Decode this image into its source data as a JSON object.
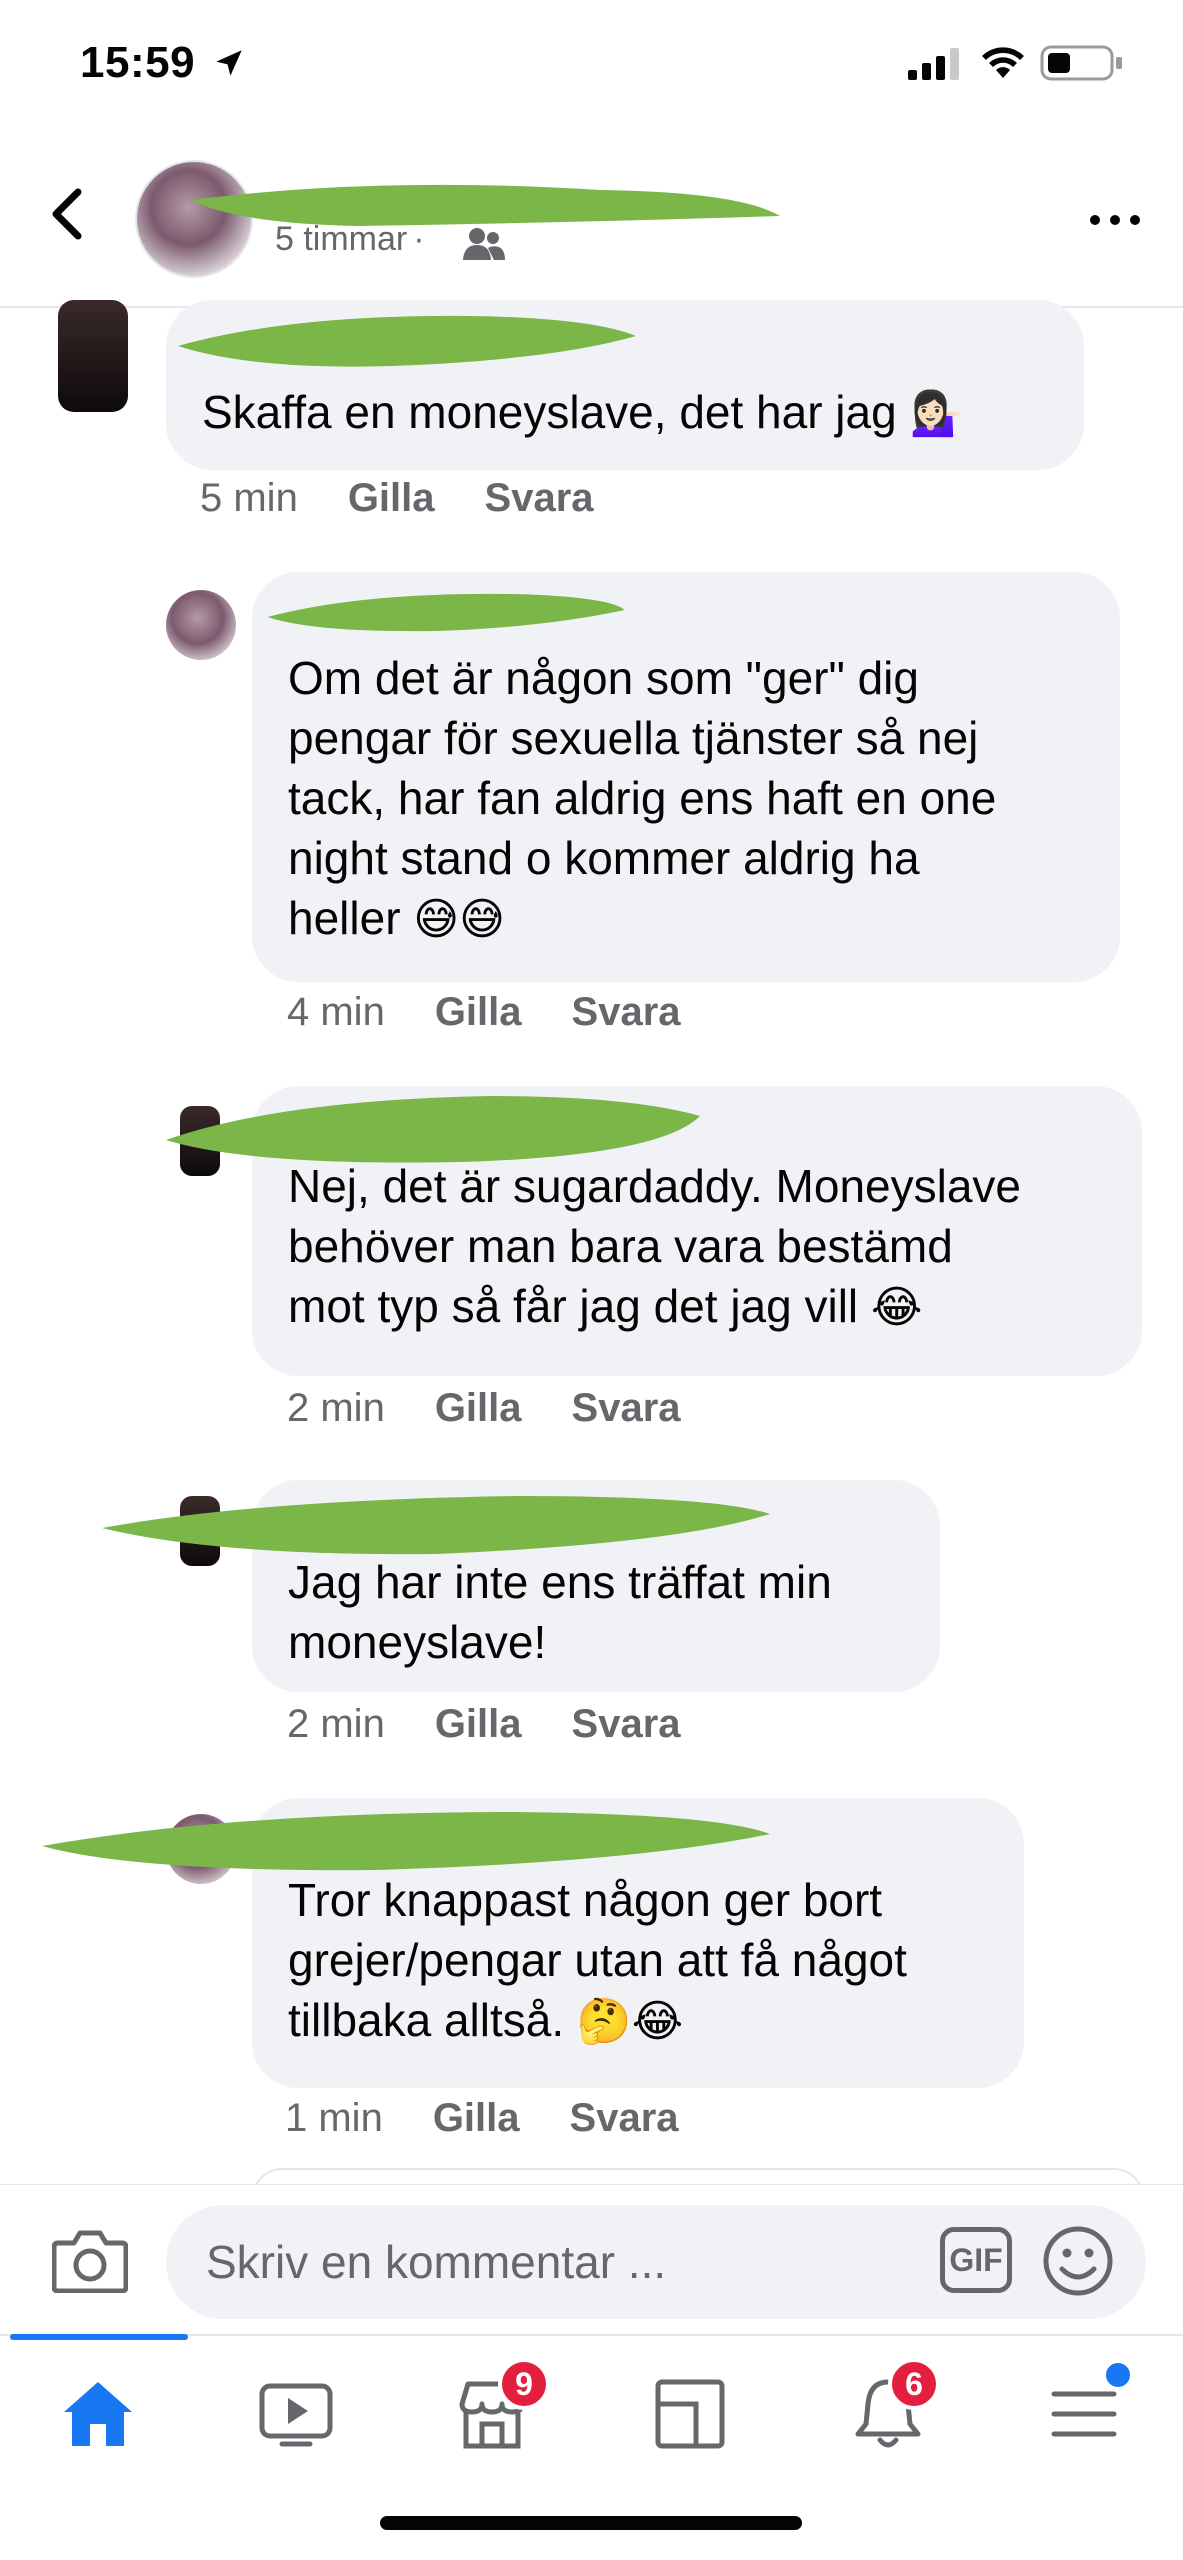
{
  "status_bar": {
    "time": "15:59"
  },
  "header": {
    "subtitle_time": "5 timmar",
    "separator": "·"
  },
  "comments": [
    {
      "text": "Skaffa en moneyslave, det har jag",
      "emoji": "💁🏻‍♀️",
      "time": "5 min",
      "like": "Gilla",
      "reply": "Svara"
    },
    {
      "text": "Om det är någon som \"ger\" dig\npengar för sexuella tjänster så nej\ntack, har fan aldrig ens haft en one\nnight stand o kommer aldrig ha\nheller",
      "emoji": "😅😅",
      "time": "4 min",
      "like": "Gilla",
      "reply": "Svara"
    },
    {
      "text": "Nej, det är sugardaddy. Moneyslave\nbehöver man bara vara bestämd\nmot typ så får jag det jag vill",
      "emoji": "😂",
      "time": "2 min",
      "like": "Gilla",
      "reply": "Svara"
    },
    {
      "text": "Jag har inte ens träffat min\nmoneyslave!",
      "emoji": "",
      "time": "2 min",
      "like": "Gilla",
      "reply": "Svara"
    },
    {
      "text": "Tror knappast någon ger bort\ngrejer/pengar utan att få något\ntillbaka alltså.",
      "emoji": "🤔😂",
      "time": "1 min",
      "like": "Gilla",
      "reply": "Svara"
    }
  ],
  "composer": {
    "placeholder": "Skriv en kommentar ...",
    "gif_label": "GIF"
  },
  "tabbar": {
    "tabs": [
      "home-icon",
      "watch-icon",
      "marketplace-icon",
      "pages-icon",
      "notifications-icon",
      "menu-icon"
    ],
    "marketplace_badge": "9",
    "notifications_badge": "6"
  },
  "colors": {
    "accent": "#1877f2",
    "bubble": "#f0f2f5",
    "redaction": "#7ab648",
    "badge": "#e41e3f"
  }
}
